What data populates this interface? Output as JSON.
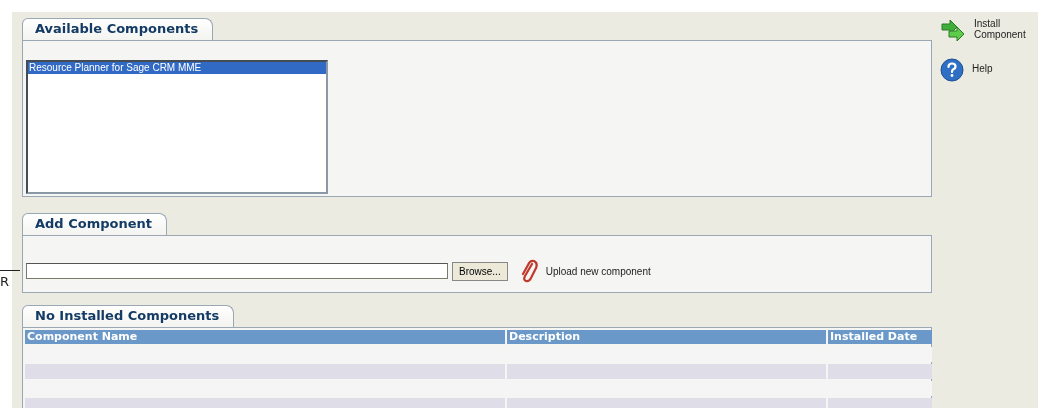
{
  "edge_text": "R",
  "available": {
    "title": "Available Components",
    "items": [
      {
        "label": "Resource Planner for Sage CRM MME",
        "selected": true
      }
    ]
  },
  "add": {
    "title": "Add Component",
    "browse": "Browse...",
    "upload": "Upload new component"
  },
  "installed": {
    "title": "No Installed Components",
    "columns": [
      "Component Name",
      "Description",
      "Installed Date"
    ]
  },
  "actions": [
    {
      "kind": "install",
      "label": "Install Component"
    },
    {
      "kind": "help",
      "label": "Help"
    }
  ]
}
